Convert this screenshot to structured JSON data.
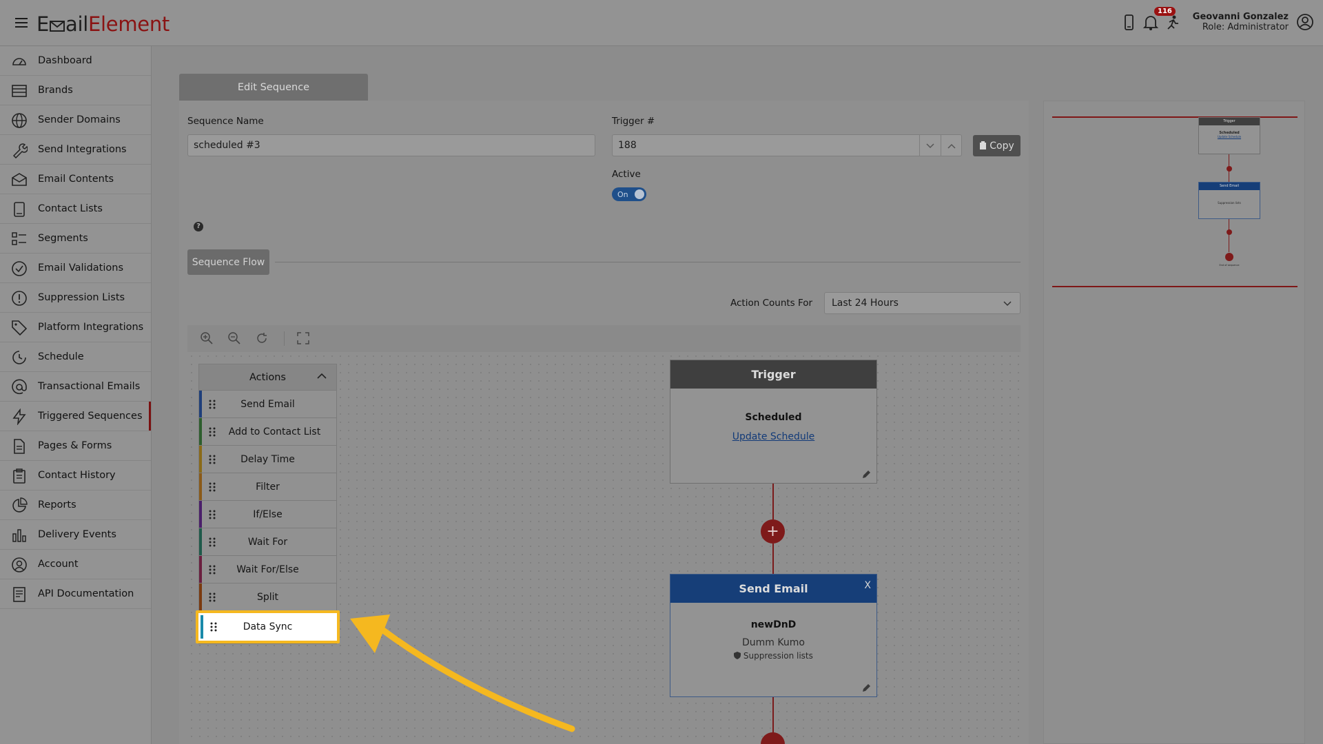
{
  "header": {
    "logo_part1": "E",
    "logo_part2": "ail",
    "logo_part3": "Element",
    "notification_count": "116",
    "user_name": "Geovanni Gonzalez",
    "user_role": "Role: Administrator"
  },
  "sidebar": {
    "items": [
      {
        "label": "Dashboard",
        "icon": "dashboard-icon"
      },
      {
        "label": "Brands",
        "icon": "brands-icon"
      },
      {
        "label": "Sender Domains",
        "icon": "globe-icon"
      },
      {
        "label": "Send Integrations",
        "icon": "wrench-icon"
      },
      {
        "label": "Email Contents",
        "icon": "envelope-icon"
      },
      {
        "label": "Contact Lists",
        "icon": "contact-book-icon"
      },
      {
        "label": "Segments",
        "icon": "segments-icon"
      },
      {
        "label": "Email Validations",
        "icon": "check-circle-icon"
      },
      {
        "label": "Suppression Lists",
        "icon": "exclamation-circle-icon"
      },
      {
        "label": "Platform Integrations",
        "icon": "tag-icon"
      },
      {
        "label": "Schedule",
        "icon": "clock-icon"
      },
      {
        "label": "Transactional Emails",
        "icon": "at-icon"
      },
      {
        "label": "Triggered Sequences",
        "icon": "lightning-icon"
      },
      {
        "label": "Pages & Forms",
        "icon": "document-icon"
      },
      {
        "label": "Contact History",
        "icon": "clipboard-icon"
      },
      {
        "label": "Reports",
        "icon": "pie-chart-icon"
      },
      {
        "label": "Delivery Events",
        "icon": "bar-chart-icon"
      },
      {
        "label": "Account",
        "icon": "user-circle-icon"
      },
      {
        "label": "API Documentation",
        "icon": "api-doc-icon"
      }
    ],
    "active": "Triggered Sequences"
  },
  "main": {
    "tab_label": "Edit Sequence",
    "sequence_name_label": "Sequence Name",
    "sequence_name_value": "scheduled #3",
    "trigger_label": "Trigger #",
    "trigger_value": "188",
    "copy_label": "Copy",
    "active_label": "Active",
    "active_toggle": "On",
    "help": "?",
    "sequence_flow_label": "Sequence Flow",
    "action_counts_label": "Action Counts For",
    "action_counts_value": "Last 24 Hours"
  },
  "actions_panel": {
    "title": "Actions",
    "items": [
      {
        "label": "Send Email",
        "color": "#1f3f7a"
      },
      {
        "label": "Add to Contact List",
        "color": "#2d5e2d"
      },
      {
        "label": "Delay Time",
        "color": "#8a6a18"
      },
      {
        "label": "Filter",
        "color": "#8a5a18"
      },
      {
        "label": "If/Else",
        "color": "#4a1f6a"
      },
      {
        "label": "Wait For",
        "color": "#1f5a4a"
      },
      {
        "label": "Wait For/Else",
        "color": "#6a1f3f"
      },
      {
        "label": "Split",
        "color": "#7a3a10"
      },
      {
        "label": "Data Sync",
        "color": "#1a8aaa"
      }
    ]
  },
  "flow": {
    "trigger_node": {
      "title": "Trigger",
      "type": "Scheduled",
      "link": "Update Schedule"
    },
    "send_email_node": {
      "title": "Send Email",
      "close": "X",
      "name": "newDnD",
      "sender": "Dumm Kumo",
      "suppression": "Suppression lists"
    },
    "plus": "+"
  },
  "minimap": {
    "trigger_title": "Trigger",
    "trigger_type": "Scheduled",
    "trigger_link": "Update Schedule",
    "send_title": "Send Email",
    "send_line": "Suppression lists",
    "end_label": "End of sequence"
  },
  "colors": {
    "accent": "#8a1313",
    "highlight": "#f5b81f",
    "trigger_header": "#3f3f3f",
    "send_email_header": "#163e78"
  }
}
